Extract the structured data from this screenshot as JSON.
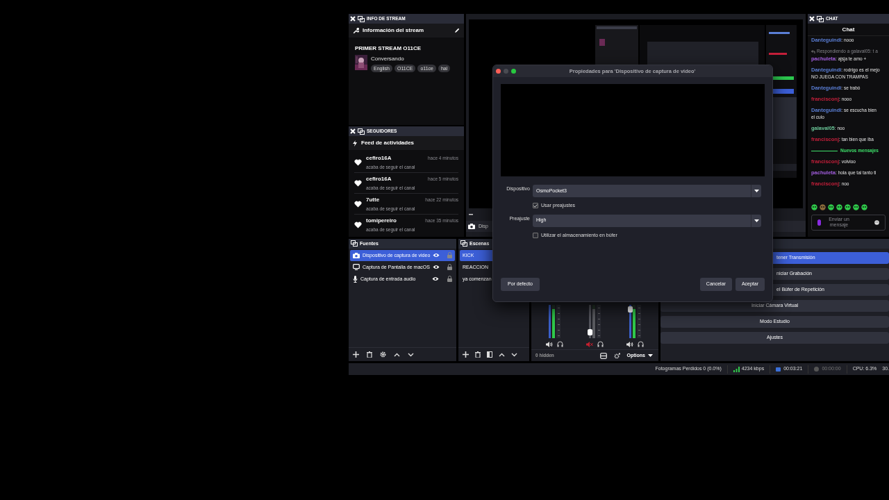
{
  "info_panel": {
    "title": "INFO DE STREAM",
    "subtitle": "Información del stream",
    "stream_title": "PRIMER STREAM O11CE",
    "category": "Conversando",
    "tags": [
      "English",
      "O11CE",
      "o11ce",
      "hal"
    ]
  },
  "followers_panel": {
    "title": "SEGUIDORES",
    "subtitle": "Feed de actividades",
    "items": [
      {
        "name": "cefiro16A",
        "time": "hace 4 minutos",
        "action": "acaba de seguir el canal"
      },
      {
        "name": "cefiro16A",
        "time": "hace 5 minutos",
        "action": "acaba de seguir el canal"
      },
      {
        "name": "7utte",
        "time": "hace 22 minutos",
        "action": "acaba de seguir el canal"
      },
      {
        "name": "tomipereiro",
        "time": "hace 35 minutos",
        "action": "acaba de seguir el canal"
      }
    ]
  },
  "preview": {
    "source_label": "Disp"
  },
  "chat": {
    "title": "CHAT",
    "heading": "Chat",
    "placeholder": "Enviar un mensaje",
    "messages": [
      {
        "kind": "message",
        "user": "Danteguindi",
        "color": "#5b7fd6",
        "text": ": nooo"
      },
      {
        "kind": "reply",
        "text": "Respondiendo a galaval05: t a"
      },
      {
        "kind": "message",
        "user": "pachuleta",
        "color": "#a45ee0",
        "text": ": ajsja te amo +"
      },
      {
        "kind": "message",
        "user": "Danteguindi",
        "color": "#5b7fd6",
        "text": ": rodrigo es el mejo",
        "continuation": "NO JUEGA CON TRAMPAS"
      },
      {
        "kind": "message",
        "user": "Danteguindi",
        "color": "#5b7fd6",
        "text": ": se trabó"
      },
      {
        "kind": "message",
        "user": "francisconj",
        "color": "#c41f3a",
        "text": ": nooo"
      },
      {
        "kind": "message",
        "user": "Danteguindi",
        "color": "#5b7fd6",
        "text": ": se escucha bien",
        "continuation": "el culo"
      },
      {
        "kind": "message",
        "user": "galaval05",
        "color": "#6cc99a",
        "text": ": noo"
      },
      {
        "kind": "message",
        "user": "francisconj",
        "color": "#c41f3a",
        "text": ": tan bien que iba"
      },
      {
        "kind": "divider",
        "text": "Nuevos mensajes"
      },
      {
        "kind": "message",
        "user": "francisconj",
        "color": "#c41f3a",
        "text": ": volvioo"
      },
      {
        "kind": "message",
        "user": "pachuleta",
        "color": "#a45ee0",
        "text": ": hola que tal tanto ti"
      },
      {
        "kind": "message",
        "user": "francisconj",
        "color": "#c41f3a",
        "text": ": noo"
      }
    ]
  },
  "sources": {
    "title": "Fuentes",
    "items": [
      {
        "label": "Dispositivo de captura de video",
        "kind": "camera",
        "selected": true
      },
      {
        "label": "Captura de Pantalla de macOS",
        "kind": "monitor",
        "selected": false
      },
      {
        "label": "Captura de entrada audio",
        "kind": "mic",
        "selected": false
      }
    ]
  },
  "scenes": {
    "title": "Escenas",
    "items": [
      {
        "label": "KICK",
        "selected": true
      },
      {
        "label": "REACCION",
        "selected": false
      },
      {
        "label": "ya comenzan",
        "selected": false
      }
    ]
  },
  "mixer": {
    "hidden_label": "0 hidden",
    "options_label": "Options",
    "channels": [
      {
        "muted": false
      },
      {
        "muted": true,
        "level": 0.1
      },
      {
        "muted": false,
        "level": 0.95
      }
    ]
  },
  "controls": {
    "buttons": [
      {
        "label": "tener Transmisión",
        "kind": "partial",
        "active": true
      },
      {
        "label": "niciar Grabación",
        "kind": "partial",
        "active": false
      },
      {
        "label": "el Búfer de Repetición",
        "kind": "partial",
        "active": false
      },
      {
        "label": "Iniciar Cámara Virtual",
        "kind": "full",
        "active": false
      },
      {
        "label": "Modo Estudio",
        "kind": "full",
        "active": false
      },
      {
        "label": "Ajustes",
        "kind": "full",
        "active": false
      }
    ]
  },
  "dialog": {
    "title": "Propiedades para 'Dispositivo de captura de video'",
    "fields": [
      {
        "kind": "select",
        "label": "Dispositivo",
        "value": "OsmoPocket3"
      },
      {
        "kind": "checkbox",
        "label": "Usar preajustes",
        "checked": true
      },
      {
        "kind": "select",
        "label": "Preajuste",
        "value": "High"
      },
      {
        "kind": "checkbox",
        "label": "Utilizar el almacenamiento en búfer",
        "checked": false
      }
    ],
    "default_button": "Por defecto",
    "buttons": [
      "Cancelar",
      "Aceptar"
    ]
  },
  "status_bar": {
    "dropped_frames": "Fotogramas Perdidos 0 (0.0%)",
    "bitrate": "4234 kbps",
    "stream_time": "00:03:21",
    "record_time": "00:00:00",
    "cpu": "CPU: 6.3%",
    "fps": "30."
  }
}
